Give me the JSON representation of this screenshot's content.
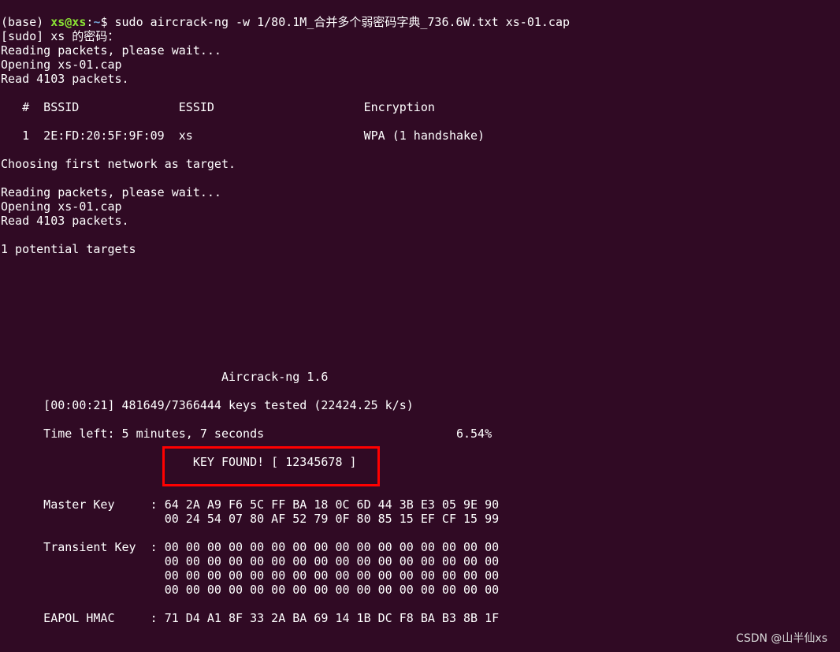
{
  "prompt": {
    "env": "(base) ",
    "user_host": "xs@xs",
    "sep": ":",
    "path": "~",
    "symbol": "$ ",
    "command": "sudo aircrack-ng -w 1/80.1M_合并多个弱密码字典_736.6W.txt xs-01.cap"
  },
  "sudo_prompt": "[sudo] xs 的密码：",
  "first_pass": {
    "reading": "Reading packets, please wait...",
    "opening": "Opening xs-01.cap",
    "read": "Read 4103 packets."
  },
  "network_table": {
    "header": "   #  BSSID              ESSID                     Encryption",
    "row": "   1  2E:FD:20:5F:9F:09  xs                        WPA (1 handshake)"
  },
  "choosing": "Choosing first network as target.",
  "second_pass": {
    "reading": "Reading packets, please wait...",
    "opening": "Opening xs-01.cap",
    "read": "Read 4103 packets."
  },
  "potential_targets": "1 potential targets",
  "crack": {
    "title": "                               Aircrack-ng 1.6",
    "progress": "      [00:00:21] 481649/7366444 keys tested (22424.25 k/s)",
    "time_left": "      Time left: 5 minutes, 7 seconds                           6.54%",
    "key_found": "                           KEY FOUND! [ 12345678 ]",
    "master_key_1": "      Master Key     : 64 2A A9 F6 5C FF BA 18 0C 6D 44 3B E3 05 9E 90",
    "master_key_2": "                       00 24 54 07 80 AF 52 79 0F 80 85 15 EF CF 15 99",
    "transient_key_1": "      Transient Key  : 00 00 00 00 00 00 00 00 00 00 00 00 00 00 00 00",
    "transient_key_2": "                       00 00 00 00 00 00 00 00 00 00 00 00 00 00 00 00",
    "transient_key_3": "                       00 00 00 00 00 00 00 00 00 00 00 00 00 00 00 00",
    "transient_key_4": "                       00 00 00 00 00 00 00 00 00 00 00 00 00 00 00 00",
    "eapol_hmac": "      EAPOL HMAC     : 71 D4 A1 8F 33 2A BA 69 14 1B DC F8 BA B3 8B 1F"
  },
  "watermark": "CSDN @山半仙xs",
  "colors": {
    "background": "#300a24",
    "text": "#ffffff",
    "prompt_user": "#8ae234",
    "prompt_path": "#729fcf",
    "highlight_box": "#ff0000"
  }
}
